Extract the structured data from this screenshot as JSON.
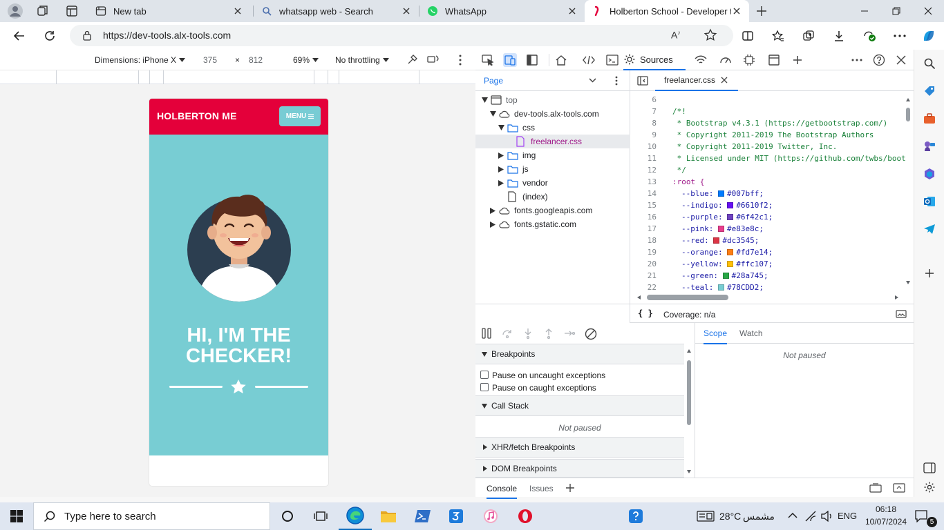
{
  "browser": {
    "tabs": [
      {
        "label": "New tab",
        "icon": "new-tab-icon"
      },
      {
        "label": "whatsapp web - Search",
        "icon": "search-icon"
      },
      {
        "label": "WhatsApp",
        "icon": "whatsapp-icon"
      },
      {
        "label": "Holberton School - Developer to",
        "icon": "holberton-icon"
      }
    ],
    "url": "https://dev-tools.alx-tools.com"
  },
  "device_toolbar": {
    "dimensions_label": "Dimensions: iPhone X",
    "width": "375",
    "times": "×",
    "height": "812",
    "zoom": "69%",
    "throttling": "No throttling"
  },
  "phone": {
    "brand": "HOLBERTON ME",
    "menu_label": "MENU",
    "headline_line1": "HI, I'M THE",
    "headline_line2": "CHECKER!"
  },
  "devtools": {
    "active_panel": "Sources",
    "page_tab": "Page",
    "tree": [
      {
        "label": "top"
      },
      {
        "label": "dev-tools.alx-tools.com"
      },
      {
        "label": "css"
      },
      {
        "label": "freelancer.css"
      },
      {
        "label": "img"
      },
      {
        "label": "js"
      },
      {
        "label": "vendor"
      },
      {
        "label": "(index)"
      },
      {
        "label": "fonts.googleapis.com"
      },
      {
        "label": "fonts.gstatic.com"
      }
    ],
    "file_tab": "freelancer.css",
    "code_lines": [
      {
        "n": "6",
        "t": ""
      },
      {
        "n": "7",
        "t": "/*!"
      },
      {
        "n": "8",
        "t": " * Bootstrap v4.3.1 (https://getbootstrap.com/)"
      },
      {
        "n": "9",
        "t": " * Copyright 2011-2019 The Bootstrap Authors"
      },
      {
        "n": "10",
        "t": " * Copyright 2011-2019 Twitter, Inc."
      },
      {
        "n": "11",
        "t": " * Licensed under MIT (https://github.com/twbs/boot"
      },
      {
        "n": "12",
        "t": " */"
      },
      {
        "n": "13",
        "t": ":root {"
      },
      {
        "n": "14",
        "p": "--blue:",
        "v": "#007bff;",
        "c": "#007bff"
      },
      {
        "n": "15",
        "p": "--indigo:",
        "v": "#6610f2;",
        "c": "#6610f2"
      },
      {
        "n": "16",
        "p": "--purple:",
        "v": "#6f42c1;",
        "c": "#6f42c1"
      },
      {
        "n": "17",
        "p": "--pink:",
        "v": "#e83e8c;",
        "c": "#e83e8c"
      },
      {
        "n": "18",
        "p": "--red:",
        "v": "#dc3545;",
        "c": "#dc3545"
      },
      {
        "n": "19",
        "p": "--orange:",
        "v": "#fd7e14;",
        "c": "#fd7e14"
      },
      {
        "n": "20",
        "p": "--yellow:",
        "v": "#ffc107;",
        "c": "#ffc107"
      },
      {
        "n": "21",
        "p": "--green:",
        "v": "#28a745;",
        "c": "#28a745"
      },
      {
        "n": "22",
        "p": "--teal:",
        "v": "#78CDD2;",
        "c": "#78CDD2"
      }
    ],
    "coverage": "Coverage: n/a",
    "braces": "{ }",
    "breakpoints": "Breakpoints",
    "pause_uncaught": "Pause on uncaught exceptions",
    "pause_caught": "Pause on caught exceptions",
    "call_stack": "Call Stack",
    "not_paused": "Not paused",
    "xhr": "XHR/fetch Breakpoints",
    "dom": "DOM Breakpoints",
    "scope_tab": "Scope",
    "watch_tab": "Watch",
    "scope_not_paused": "Not paused",
    "drawer_console": "Console",
    "drawer_issues": "Issues"
  },
  "taskbar": {
    "search_placeholder": "Type here to search",
    "temperature": "28°C",
    "weather": "مشمس",
    "language": "ENG",
    "time": "06:18",
    "date": "10/07/2024",
    "notifications": "5"
  },
  "colors": {
    "brand_red": "#e4003a",
    "hero_teal": "#78cdd3",
    "devtools_accent": "#1a73e8"
  }
}
